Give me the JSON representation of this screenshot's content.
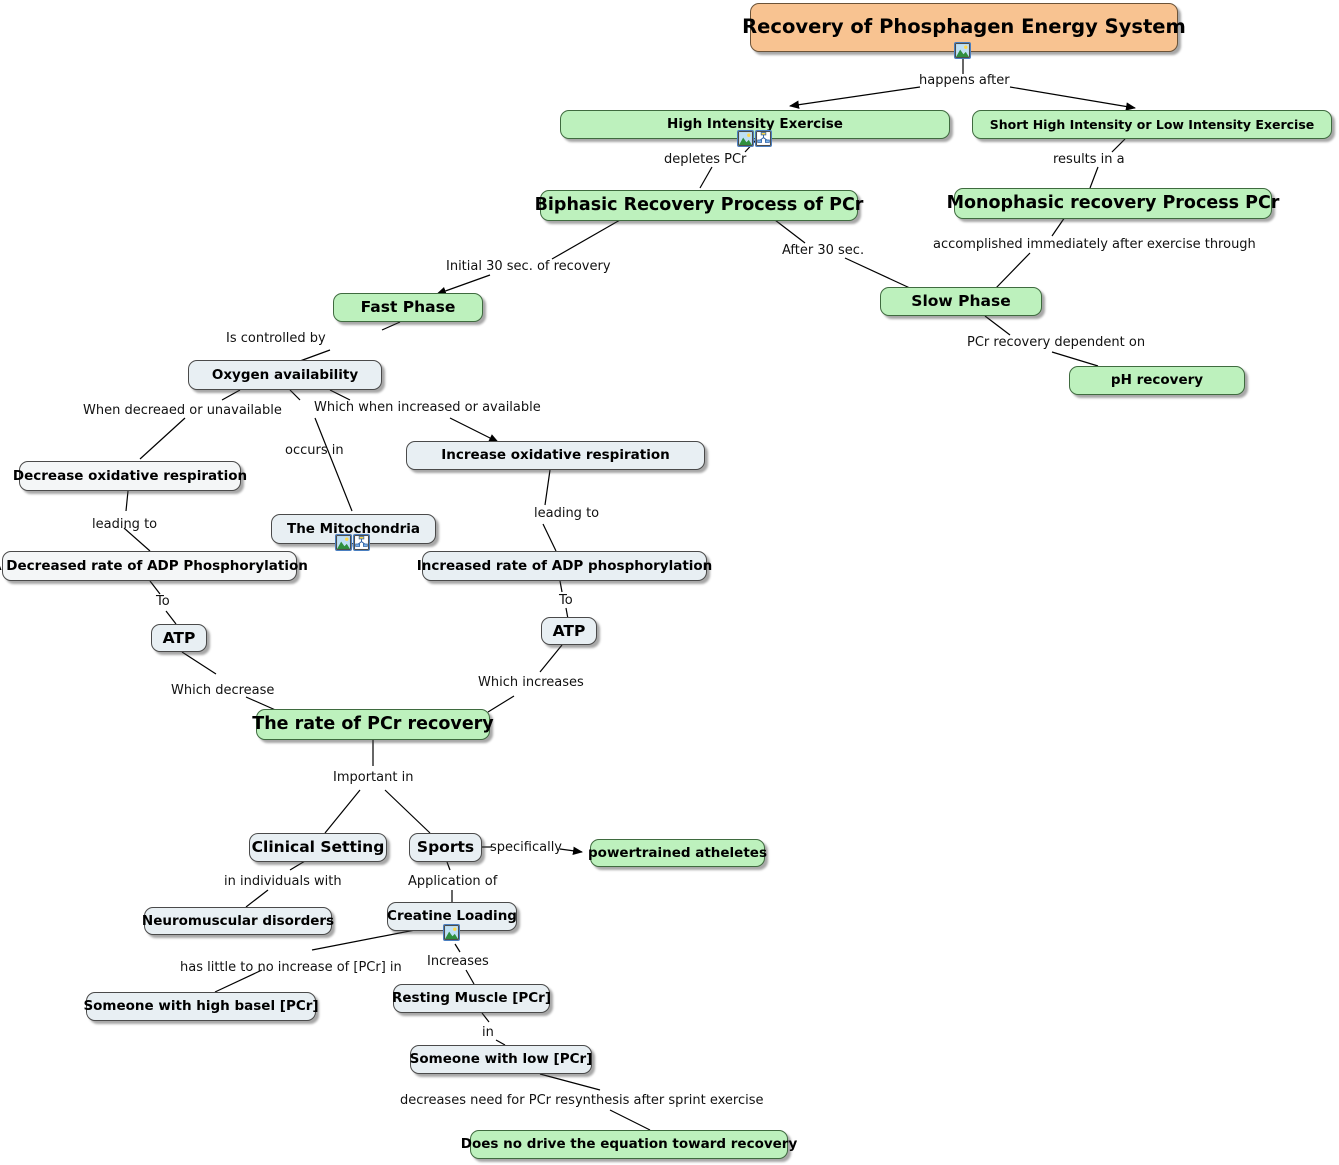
{
  "title": "Recovery of Phosphagen Energy System",
  "nodes": [
    {
      "id": "root",
      "label": "Recovery of Phosphagen Energy System"
    },
    {
      "id": "hie",
      "label": "High Intensity Exercise"
    },
    {
      "id": "shie",
      "label": "Short High Intensity or Low Intensity Exercise"
    },
    {
      "id": "biph",
      "label": "Biphasic Recovery Process of PCr"
    },
    {
      "id": "mono",
      "label": "Monophasic recovery Process PCr"
    },
    {
      "id": "fast",
      "label": "Fast Phase"
    },
    {
      "id": "slow",
      "label": "Slow Phase"
    },
    {
      "id": "ph",
      "label": "pH recovery"
    },
    {
      "id": "oxy",
      "label": "Oxygen availability"
    },
    {
      "id": "decox",
      "label": "Decrease oxidative respiration"
    },
    {
      "id": "mito",
      "label": "The Mitochondria"
    },
    {
      "id": "incox",
      "label": "Increase oxidative respiration"
    },
    {
      "id": "decadp",
      "label": "A Decreased rate of ADP Phosphorylation"
    },
    {
      "id": "incadp",
      "label": "Increased rate of ADP phosphorylation"
    },
    {
      "id": "atpL",
      "label": "ATP"
    },
    {
      "id": "atpR",
      "label": "ATP"
    },
    {
      "id": "rate",
      "label": "The rate of PCr recovery"
    },
    {
      "id": "clin",
      "label": "Clinical Setting"
    },
    {
      "id": "sports",
      "label": "Sports"
    },
    {
      "id": "power",
      "label": "powertrained atheletes"
    },
    {
      "id": "neuro",
      "label": "Neuromuscular disorders"
    },
    {
      "id": "creat",
      "label": "Creatine Loading"
    },
    {
      "id": "highb",
      "label": "Someone with high basel  [PCr]"
    },
    {
      "id": "rest",
      "label": "Resting Muscle [PCr]"
    },
    {
      "id": "lowp",
      "label": "Someone with low [PCr]"
    },
    {
      "id": "nodrive",
      "label": "Does no drive the equation toward recovery"
    }
  ],
  "edge_labels": [
    {
      "id": "e_happens",
      "text": "happens after"
    },
    {
      "id": "e_depletes",
      "text": "depletes PCr"
    },
    {
      "id": "e_results",
      "text": "results in a"
    },
    {
      "id": "e_initial",
      "text": "Initial 30 sec. of recovery"
    },
    {
      "id": "e_after30",
      "text": "After 30 sec."
    },
    {
      "id": "e_accomplished",
      "text": "accomplished immediately after exercise through"
    },
    {
      "id": "e_pcrdep",
      "text": "PCr recovery dependent on"
    },
    {
      "id": "e_controlled",
      "text": "Is  controlled by"
    },
    {
      "id": "e_decreaed",
      "text": "When decreaed or unavailable"
    },
    {
      "id": "e_occurs",
      "text": "occurs in"
    },
    {
      "id": "e_whichincr",
      "text": "Which when increased or available"
    },
    {
      "id": "e_leadingto1",
      "text": "leading to"
    },
    {
      "id": "e_leadingto2",
      "text": "leading to"
    },
    {
      "id": "e_to1",
      "text": "To"
    },
    {
      "id": "e_to2",
      "text": "To"
    },
    {
      "id": "e_whichdecrease",
      "text": "Which decrease"
    },
    {
      "id": "e_whichincreases",
      "text": "Which increases"
    },
    {
      "id": "e_important",
      "text": "Important in"
    },
    {
      "id": "e_specifically",
      "text": "specifically"
    },
    {
      "id": "e_individuals",
      "text": "in individuals with"
    },
    {
      "id": "e_application",
      "text": "Application of"
    },
    {
      "id": "e_little",
      "text": "has little to no increase of [PCr] in"
    },
    {
      "id": "e_increases",
      "text": "Increases"
    },
    {
      "id": "e_in",
      "text": "in"
    },
    {
      "id": "e_decreases",
      "text": "decreases need for PCr resynthesis after sprint exercise"
    }
  ],
  "icons": {
    "picture": "picture-icon",
    "map": "concept-map-icon"
  },
  "colors": {
    "root_fill": "#f8c391",
    "green_fill": "#bdf1bd",
    "default_fill": "#eef3f6",
    "border": "#4a4a4a",
    "link": "#000000"
  }
}
